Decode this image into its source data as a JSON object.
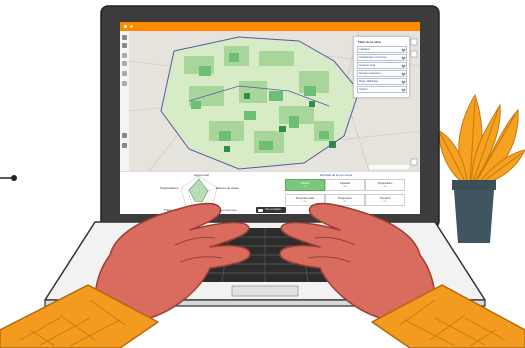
{
  "panel": {
    "title": "Filter de la carte",
    "filters": [
      "Indicateur",
      "Classification communes",
      "Contexte local",
      "Données associées",
      "Mode d'affichage",
      "Options"
    ]
  },
  "radar": {
    "labels": [
      "Appui local",
      "Mesure de valeur",
      "Organisations",
      "Transport",
      "Mise en commun"
    ]
  },
  "cards": {
    "header": "Résultat de la commune",
    "items": [
      {
        "title": "Mesure",
        "value": "2.4"
      },
      {
        "title": "Capacité",
        "value": "1.8"
      },
      {
        "title": "Organisation",
        "value": "3.1"
      },
      {
        "title": "Proportionnalité",
        "value": "2.2"
      },
      {
        "title": "Progression",
        "value": "1.5"
      },
      {
        "title": "Transport",
        "value": "2.7"
      }
    ]
  },
  "toggle": {
    "label": "Vue complète"
  },
  "colors": {
    "orange": "#ff8a00",
    "map_green_light": "#cfe8bf",
    "map_green_dark": "#2f8f45",
    "hand": "#d96b5f",
    "sleeve": "#f39b1f",
    "plant_orange": "#f4a21f",
    "pot": "#3f5661"
  }
}
